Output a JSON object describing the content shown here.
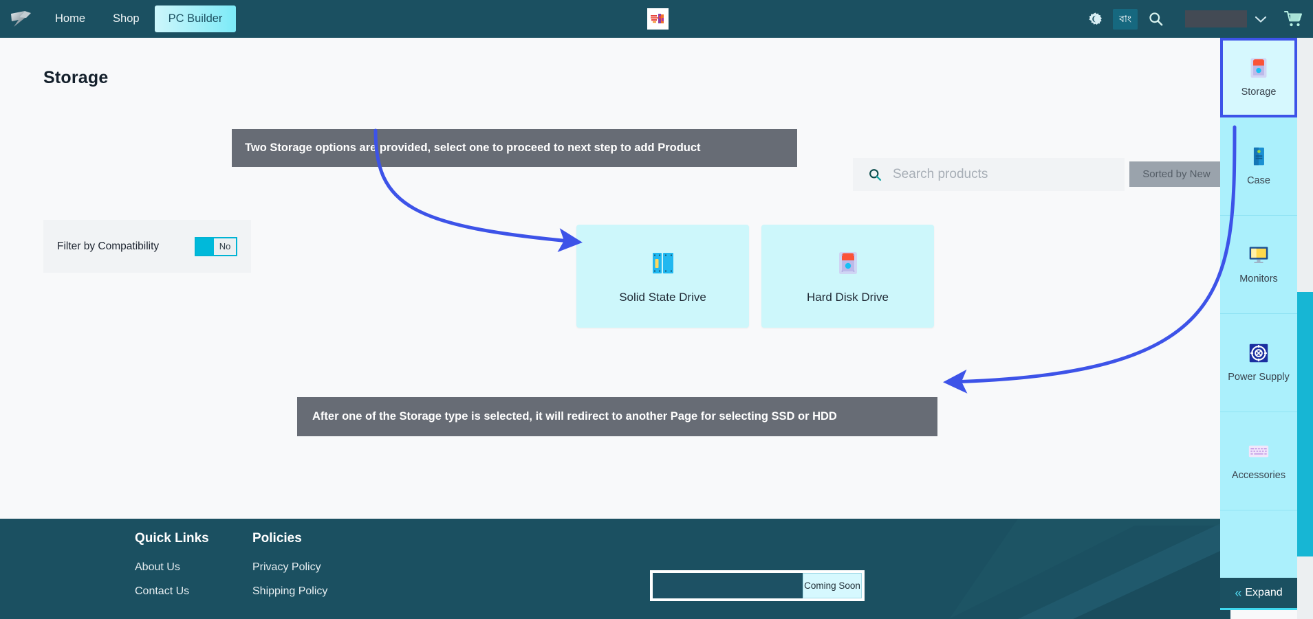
{
  "header": {
    "logo_name": "brand-logo",
    "nav": [
      {
        "label": "Home",
        "active": false
      },
      {
        "label": "Shop",
        "active": false
      },
      {
        "label": "PC Builder",
        "active": true
      }
    ],
    "center_badge": "promo-tile",
    "icons": {
      "theme": "gear-brightness-icon",
      "search": "search-icon",
      "cart": "cart-icon",
      "chevron": "chevron-down-icon"
    },
    "language_label": "বাং",
    "account_placeholder": ""
  },
  "main": {
    "page_title": "Storage",
    "filter": {
      "label": "Filter by Compatibility",
      "toggle_value": "No"
    },
    "search": {
      "placeholder": "Search products",
      "value": "",
      "sort_label": "Sorted by New"
    },
    "options": [
      {
        "label": "Solid State Drive",
        "icon": "ssd-icon"
      },
      {
        "label": "Hard Disk Drive",
        "icon": "hdd-icon"
      }
    ],
    "annotations": [
      "Two Storage options are provided, select one to proceed to next step to add Product",
      "After one of the Storage type is selected, it will redirect to another Page for selecting SSD or HDD"
    ]
  },
  "sidebar": {
    "items": [
      {
        "label": "Storage",
        "icon": "hdd-icon",
        "selected": true
      },
      {
        "label": "Case",
        "icon": "pc-case-icon",
        "selected": false
      },
      {
        "label": "Monitors",
        "icon": "monitor-icon",
        "selected": false
      },
      {
        "label": "Power Supply",
        "icon": "power-supply-icon",
        "selected": false
      },
      {
        "label": "Accessories",
        "icon": "accessories-icon",
        "selected": false
      }
    ],
    "expand_label": "Expand"
  },
  "footer": {
    "columns": [
      {
        "heading": "Quick Links",
        "links": [
          "About Us",
          "Contact Us"
        ]
      },
      {
        "heading": "Policies",
        "links": [
          "Privacy Policy",
          "Shipping Policy"
        ]
      }
    ],
    "newsletter": {
      "value": "",
      "button_label": "Coming Soon"
    }
  },
  "colors": {
    "header_bg": "#1b5061",
    "accent_cyan": "#abf0fc",
    "annotation_bg": "#676c75",
    "arrow_blue": "#3d53e8",
    "selected_border": "#3d53e8",
    "toggle_on": "#00b9da"
  }
}
